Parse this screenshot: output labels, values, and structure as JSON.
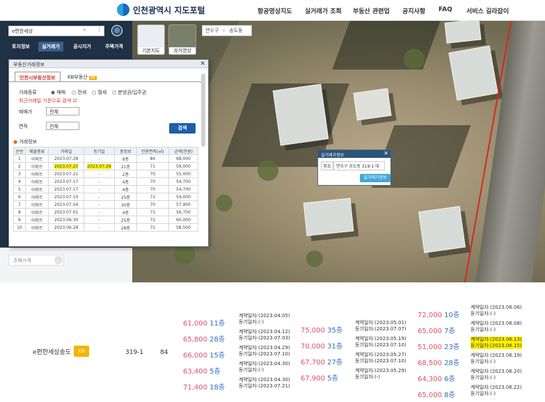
{
  "header": {
    "logo": "인천광역시 지도포털",
    "nav": [
      "항공영상지도",
      "실거래가 조회",
      "부동산 관련업",
      "공지사항",
      "FAQ",
      "서비스 길라잡이"
    ]
  },
  "map": {
    "maptypes": [
      "기본지도",
      "과거영상"
    ],
    "breadcrumb": [
      "연수구",
      "송도동"
    ]
  },
  "left": {
    "search_value": "e편한세상",
    "tabs": [
      "토지정보",
      "실거래가",
      "공시지가",
      "주택가격"
    ],
    "lower_item": "주택가격"
  },
  "dialog": {
    "title": "부동산거래정보",
    "tabs": [
      "인천시부동산정보",
      "KB부동산"
    ],
    "kb_badge": "KB",
    "trade_type_label": "거래종류",
    "trade_types": [
      "매매",
      "전세",
      "월세",
      "분양권/입주권"
    ],
    "recent_note": "최근거래일 기준으로 검색",
    "price_label": "매매가",
    "price_value": "전체",
    "area_label": "면적",
    "area_value": "전체",
    "search_button": "검색",
    "section_title": "거래정보",
    "columns": [
      "순번",
      "매물종류",
      "거래일",
      "등기일",
      "층정보",
      "전용면적(㎡)",
      "금액(만원)"
    ],
    "rows": [
      [
        "1",
        "아파트",
        "2023.07.28",
        "-",
        "9층",
        "84",
        "68,000"
      ],
      [
        "2",
        "아파트",
        "2023.07.25",
        "2023.07.28",
        "21층",
        "71",
        "59,000"
      ],
      [
        "3",
        "아파트",
        "2023.07.21",
        "-",
        "2층",
        "70",
        "55,000"
      ],
      [
        "4",
        "아파트",
        "2023.07.17",
        "-",
        "4층",
        "70",
        "54,700"
      ],
      [
        "5",
        "아파트",
        "2023.07.17",
        "-",
        "4층",
        "70",
        "54,700"
      ],
      [
        "6",
        "아파트",
        "2023.07.10",
        "-",
        "25층",
        "71",
        "54,000"
      ],
      [
        "7",
        "아파트",
        "2023.07.04",
        "-",
        "30층",
        "70",
        "57,900"
      ],
      [
        "8",
        "아파트",
        "2023.07.01",
        "-",
        "4층",
        "71",
        "56,700"
      ],
      [
        "9",
        "아파트",
        "2023.06.30",
        "-",
        "25층",
        "71",
        "60,000"
      ],
      [
        "10",
        "아파트",
        "2023.06.28",
        "-",
        "28층",
        "71",
        "58,500"
      ]
    ]
  },
  "popup": {
    "title": "실거래가정보",
    "addr_label": "주소",
    "addr_value": "연수구 송도동 319-1 대",
    "button": "실거래가정보"
  },
  "bottom": {
    "brand": "e편한세상송도",
    "brand_badge": "KB",
    "lot": "319-1",
    "area": "84",
    "col1": [
      {
        "price": "61,000",
        "floor": "11층",
        "d1": "계약일자:(2023.04.05)",
        "d2": "등기일자:(-)"
      },
      {
        "price": "65,800",
        "floor": "28층",
        "d1": "계약일자:(2023.04.12)",
        "d2": "등기일자:(2023.07.03)"
      },
      {
        "price": "66,000",
        "floor": "15층",
        "d1": "계약일자:(2023.04.29)",
        "d2": "등기일자:(2023.07.10)"
      },
      {
        "price": "63,400",
        "floor": "5층",
        "d1": "계약일자:(2023.04.30)",
        "d2": "등기일자:(-)"
      },
      {
        "price": "71,400",
        "floor": "18층",
        "d1": "계약일자:(2023.04.30)",
        "d2": "등기일자:(2023.07.21)"
      }
    ],
    "col2": [
      {
        "price": "75,000",
        "floor": "35층",
        "d1": "계약일자:(2023.05.01)",
        "d2": "등기일자:(2023.07.07)"
      },
      {
        "price": "70,000",
        "floor": "31층",
        "d1": "계약일자:(2023.05.19)",
        "d2": "등기일자:(2023.07.10)"
      },
      {
        "price": "67,700",
        "floor": "27층",
        "d1": "계약일자:(2023.05.27)",
        "d2": "등기일자:(2023.07.10)"
      },
      {
        "price": "67,900",
        "floor": "5층",
        "d1": "계약일자:(2023.05.29)",
        "d2": "등기일자:(-)"
      }
    ],
    "col3": [
      {
        "price": "72,000",
        "floor": "10층",
        "d1": "계약일자:(2023.06.06)",
        "d2": "등기일자:(-)"
      },
      {
        "price": "65,000",
        "floor": "7층",
        "d1": "계약일자:(2023.06.08)",
        "d2": "등기일자:(-)"
      },
      {
        "price": "51,000",
        "floor": "23층",
        "d1": "계약일자:(2023.06.13)",
        "d2": "등기일자:(2023.06.15)"
      },
      {
        "price": "68,500",
        "floor": "28층",
        "d1": "계약일자:(2023.06.19)",
        "d2": "등기일자:(-)"
      },
      {
        "price": "64,300",
        "floor": "6층",
        "d1": "계약일자:(2023.06.20)",
        "d2": "등기일자:(-)"
      },
      {
        "price": "65,000",
        "floor": "8층",
        "d1": "계약일자:(2023.06.22)",
        "d2": "등기일자:(-)"
      }
    ]
  }
}
